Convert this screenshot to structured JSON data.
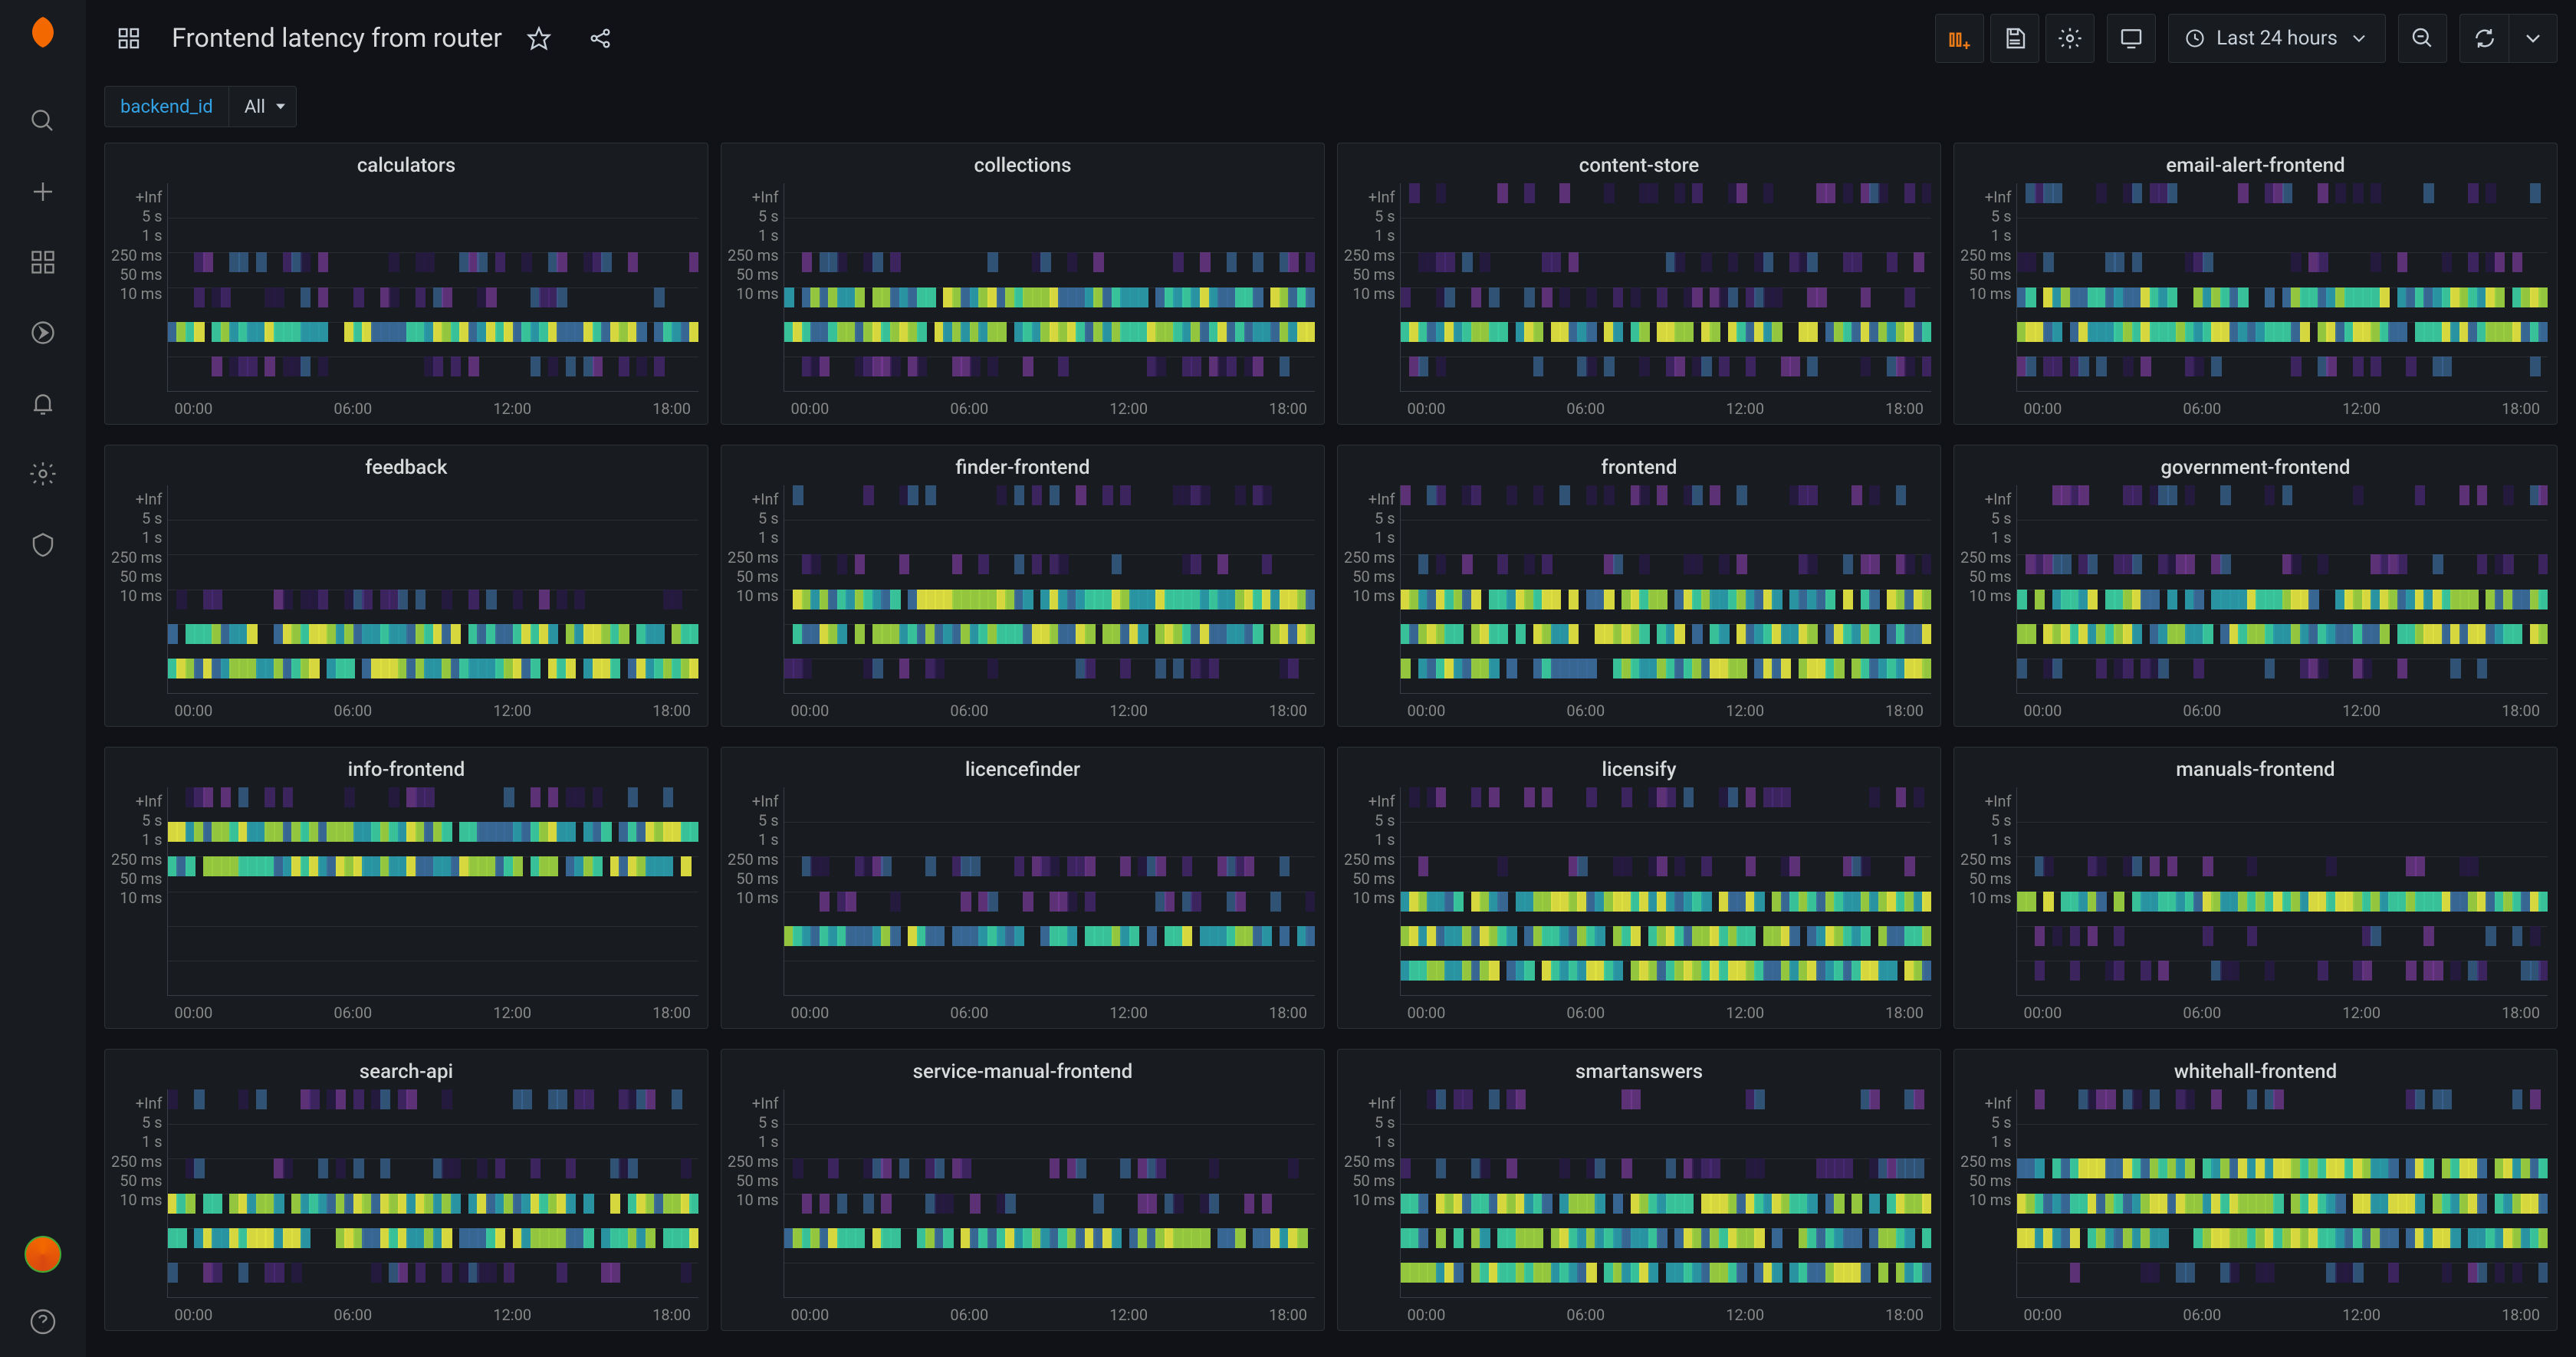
{
  "header": {
    "title": "Frontend latency from router",
    "timerange_label": "Last 24 hours"
  },
  "variables": {
    "label": "backend_id",
    "value": "All"
  },
  "chart_data": [
    {
      "type": "heatmap",
      "title": "calculators",
      "y_buckets": [
        "+Inf",
        "5 s",
        "1 s",
        "250 ms",
        "50 ms",
        "10 ms"
      ],
      "x_ticks": [
        "00:00",
        "06:00",
        "12:00",
        "18:00"
      ],
      "dominant_rows": [
        "50 ms"
      ],
      "sparse_rows": [
        "1 s",
        "250 ms",
        "10 ms"
      ]
    },
    {
      "type": "heatmap",
      "title": "collections",
      "y_buckets": [
        "+Inf",
        "5 s",
        "1 s",
        "250 ms",
        "50 ms",
        "10 ms"
      ],
      "x_ticks": [
        "00:00",
        "06:00",
        "12:00",
        "18:00"
      ],
      "dominant_rows": [
        "250 ms",
        "50 ms"
      ],
      "sparse_rows": [
        "1 s",
        "10 ms"
      ]
    },
    {
      "type": "heatmap",
      "title": "content-store",
      "y_buckets": [
        "+Inf",
        "5 s",
        "1 s",
        "250 ms",
        "50 ms",
        "10 ms"
      ],
      "x_ticks": [
        "00:00",
        "06:00",
        "12:00",
        "18:00"
      ],
      "dominant_rows": [
        "50 ms"
      ],
      "sparse_rows": [
        "1 s",
        "250 ms",
        "10 ms",
        "+Inf"
      ]
    },
    {
      "type": "heatmap",
      "title": "email-alert-frontend",
      "y_buckets": [
        "+Inf",
        "5 s",
        "1 s",
        "250 ms",
        "50 ms",
        "10 ms"
      ],
      "x_ticks": [
        "00:00",
        "06:00",
        "12:00",
        "18:00"
      ],
      "dominant_rows": [
        "250 ms",
        "50 ms"
      ],
      "sparse_rows": [
        "1 s",
        "10 ms",
        "+Inf"
      ]
    },
    {
      "type": "heatmap",
      "title": "feedback",
      "y_buckets": [
        "+Inf",
        "5 s",
        "1 s",
        "250 ms",
        "50 ms",
        "10 ms"
      ],
      "x_ticks": [
        "00:00",
        "06:00",
        "12:00",
        "18:00"
      ],
      "dominant_rows": [
        "50 ms",
        "10 ms"
      ],
      "sparse_rows": [
        "250 ms"
      ]
    },
    {
      "type": "heatmap",
      "title": "finder-frontend",
      "y_buckets": [
        "+Inf",
        "5 s",
        "1 s",
        "250 ms",
        "50 ms",
        "10 ms"
      ],
      "x_ticks": [
        "00:00",
        "06:00",
        "12:00",
        "18:00"
      ],
      "dominant_rows": [
        "250 ms",
        "50 ms"
      ],
      "sparse_rows": [
        "1 s",
        "10 ms",
        "+Inf"
      ]
    },
    {
      "type": "heatmap",
      "title": "frontend",
      "y_buckets": [
        "+Inf",
        "5 s",
        "1 s",
        "250 ms",
        "50 ms",
        "10 ms"
      ],
      "x_ticks": [
        "00:00",
        "06:00",
        "12:00",
        "18:00"
      ],
      "dominant_rows": [
        "50 ms",
        "10 ms",
        "250 ms"
      ],
      "sparse_rows": [
        "1 s",
        "+Inf"
      ]
    },
    {
      "type": "heatmap",
      "title": "government-frontend",
      "y_buckets": [
        "+Inf",
        "5 s",
        "1 s",
        "250 ms",
        "50 ms",
        "10 ms"
      ],
      "x_ticks": [
        "00:00",
        "06:00",
        "12:00",
        "18:00"
      ],
      "dominant_rows": [
        "250 ms",
        "50 ms"
      ],
      "sparse_rows": [
        "1 s",
        "10 ms",
        "+Inf"
      ]
    },
    {
      "type": "heatmap",
      "title": "info-frontend",
      "y_buckets": [
        "+Inf",
        "5 s",
        "1 s",
        "250 ms",
        "50 ms",
        "10 ms"
      ],
      "x_ticks": [
        "00:00",
        "06:00",
        "12:00",
        "18:00"
      ],
      "dominant_rows": [
        "5 s",
        "1 s"
      ],
      "sparse_rows": [
        "+Inf"
      ]
    },
    {
      "type": "heatmap",
      "title": "licencefinder",
      "y_buckets": [
        "+Inf",
        "5 s",
        "1 s",
        "250 ms",
        "50 ms",
        "10 ms"
      ],
      "x_ticks": [
        "00:00",
        "06:00",
        "12:00",
        "18:00"
      ],
      "dominant_rows": [
        "50 ms"
      ],
      "sparse_rows": [
        "250 ms",
        "1 s"
      ]
    },
    {
      "type": "heatmap",
      "title": "licensify",
      "y_buckets": [
        "+Inf",
        "5 s",
        "1 s",
        "250 ms",
        "50 ms",
        "10 ms"
      ],
      "x_ticks": [
        "00:00",
        "06:00",
        "12:00",
        "18:00"
      ],
      "dominant_rows": [
        "250 ms",
        "50 ms",
        "10 ms"
      ],
      "sparse_rows": [
        "1 s",
        "+Inf"
      ]
    },
    {
      "type": "heatmap",
      "title": "manuals-frontend",
      "y_buckets": [
        "+Inf",
        "5 s",
        "1 s",
        "250 ms",
        "50 ms",
        "10 ms"
      ],
      "x_ticks": [
        "00:00",
        "06:00",
        "12:00",
        "18:00"
      ],
      "dominant_rows": [
        "250 ms"
      ],
      "sparse_rows": [
        "1 s",
        "50 ms",
        "10 ms"
      ]
    },
    {
      "type": "heatmap",
      "title": "search-api",
      "y_buckets": [
        "+Inf",
        "5 s",
        "1 s",
        "250 ms",
        "50 ms",
        "10 ms"
      ],
      "x_ticks": [
        "00:00",
        "06:00",
        "12:00",
        "18:00"
      ],
      "dominant_rows": [
        "250 ms",
        "50 ms"
      ],
      "sparse_rows": [
        "1 s",
        "+Inf",
        "10 ms"
      ]
    },
    {
      "type": "heatmap",
      "title": "service-manual-frontend",
      "y_buckets": [
        "+Inf",
        "5 s",
        "1 s",
        "250 ms",
        "50 ms",
        "10 ms"
      ],
      "x_ticks": [
        "00:00",
        "06:00",
        "12:00",
        "18:00"
      ],
      "dominant_rows": [
        "50 ms"
      ],
      "sparse_rows": [
        "250 ms",
        "1 s"
      ]
    },
    {
      "type": "heatmap",
      "title": "smartanswers",
      "y_buckets": [
        "+Inf",
        "5 s",
        "1 s",
        "250 ms",
        "50 ms",
        "10 ms"
      ],
      "x_ticks": [
        "00:00",
        "06:00",
        "12:00",
        "18:00"
      ],
      "dominant_rows": [
        "250 ms",
        "50 ms",
        "10 ms"
      ],
      "sparse_rows": [
        "1 s",
        "+Inf"
      ]
    },
    {
      "type": "heatmap",
      "title": "whitehall-frontend",
      "y_buckets": [
        "+Inf",
        "5 s",
        "1 s",
        "250 ms",
        "50 ms",
        "10 ms"
      ],
      "x_ticks": [
        "00:00",
        "06:00",
        "12:00",
        "18:00"
      ],
      "dominant_rows": [
        "1 s",
        "250 ms",
        "50 ms"
      ],
      "sparse_rows": [
        "+Inf",
        "10 ms"
      ]
    }
  ],
  "colors": {
    "heatmap_palette": [
      "#2a1a4a",
      "#4b2a7a",
      "#7a3a9a",
      "#3a6a9a",
      "#2a9aaa",
      "#3acaa0",
      "#9ad040",
      "#e0e040"
    ]
  }
}
